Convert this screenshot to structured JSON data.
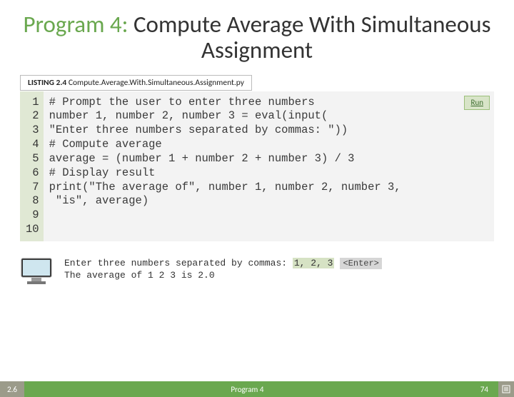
{
  "title": {
    "accent": "Program 4:",
    "rest": " Compute Average With Simultaneous Assignment"
  },
  "listing": {
    "label": "LISTING 2.4",
    "file": "Compute.Average.With.Simultaneous.Assignment.py"
  },
  "run_label": "Run",
  "code": {
    "line_numbers": [
      "1",
      "2",
      "3",
      "4",
      "5",
      "6",
      "7",
      "8",
      "9",
      "10"
    ],
    "lines": [
      "# Prompt the user to enter three numbers",
      "number 1, number 2, number 3 = eval(input(",
      "\"Enter three numbers separated by commas: \"))",
      "",
      "# Compute average",
      "average = (number 1 + number 2 + number 3) / 3",
      "",
      "# Display result",
      "print(\"The average of\", number 1, number 2, number 3,",
      " \"is\", average)"
    ]
  },
  "console": {
    "prompt": "Enter three numbers separated by commas: ",
    "input": "1, 2, 3",
    "enter": "<Enter>",
    "result": "The average of 1 2 3 is 2.0"
  },
  "footer": {
    "section": "2.6",
    "mid": "Program 4",
    "page": "74"
  }
}
